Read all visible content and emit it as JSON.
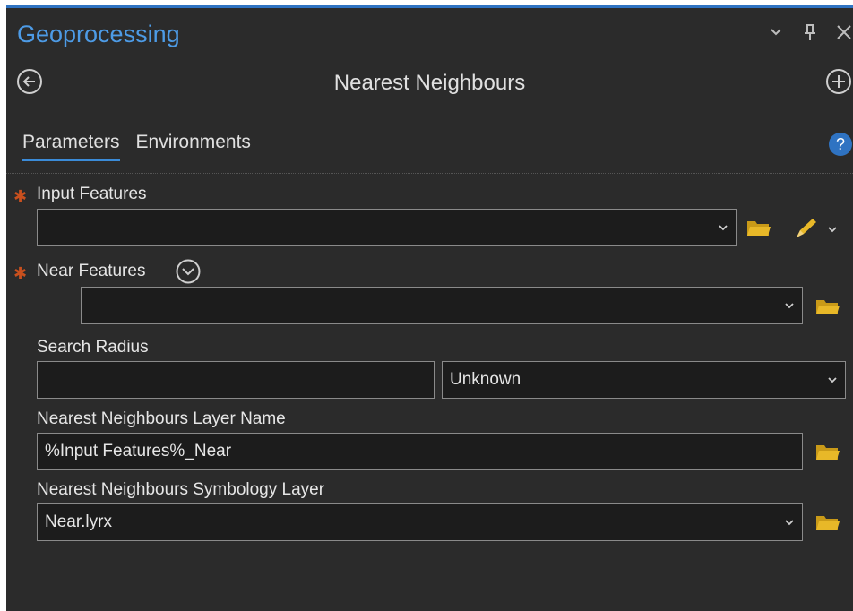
{
  "pane": {
    "title": "Geoprocessing",
    "controls": [
      "chevron-down-icon",
      "pin-icon",
      "close-icon"
    ]
  },
  "tool": {
    "title": "Nearest Neighbours"
  },
  "tabs": [
    {
      "label": "Parameters",
      "active": true
    },
    {
      "label": "Environments",
      "active": false
    }
  ],
  "params": {
    "input_features": {
      "label": "Input Features",
      "value": ""
    },
    "near_features": {
      "label": "Near Features",
      "value": ""
    },
    "search_radius": {
      "label": "Search Radius",
      "value": "",
      "unit": "Unknown"
    },
    "layer_name": {
      "label": "Nearest Neighbours Layer Name",
      "value": "%Input Features%_Near"
    },
    "symbology_layer": {
      "label": "Nearest Neighbours Symbology Layer",
      "value": "Near.lyrx"
    }
  },
  "colors": {
    "accent": "#2f73c2",
    "title_blue": "#4d9be6",
    "required": "#c9501e",
    "folder": "#e8b828",
    "background": "#2b2b2b",
    "field_bg": "#1c1c1c"
  }
}
